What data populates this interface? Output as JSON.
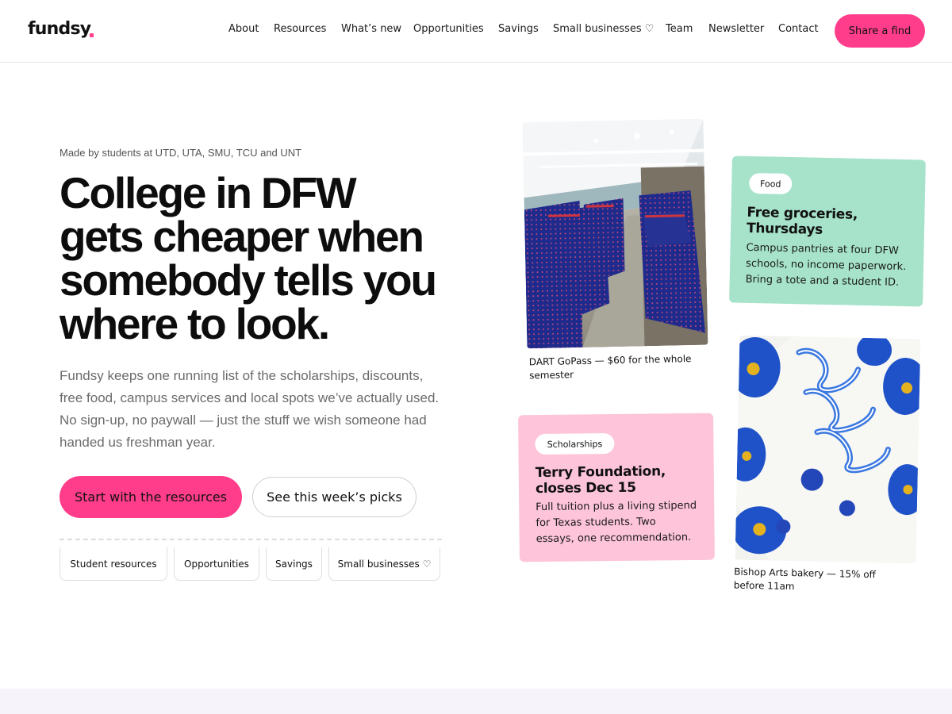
{
  "brand": {
    "name": "fundsy",
    "accent": "#ff3d8b"
  },
  "nav": {
    "items": [
      "About",
      "Resources",
      "What’s new",
      "Opportunities",
      "Savings",
      "Small businesses ♡",
      "Team",
      "Newsletter",
      "Contact"
    ],
    "cta_label": "Share a find"
  },
  "hero": {
    "eyebrow": "Made by students at UTD, UTA, SMU, TCU and UNT",
    "headline_lines": [
      "College in DFW",
      "gets cheaper when",
      "somebody tells you",
      "where to look."
    ],
    "lede": "Fundsy keeps one running list of the scholarships, discounts, free food, campus services and local spots we’ve actually used. No sign-up, no paywall — just the stuff we wish someone had handed us freshman year.",
    "primary_cta": "Start with the resources",
    "secondary_cta": "See this week’s picks",
    "chips": [
      "Student resources",
      "Opportunities",
      "Savings",
      "Small businesses ♡"
    ]
  },
  "cards": {
    "train": {
      "icon": "train-interior-photo",
      "caption_lines": [
        "DART GoPass — $60 for the whole",
        "semester"
      ]
    },
    "food": {
      "tag": "Food",
      "title_lines": [
        "Free groceries,",
        "Thursdays"
      ],
      "body_lines": [
        "Campus pantries at four DFW",
        "schools, no income paperwork.",
        "Bring a tote and a student ID."
      ],
      "color": "#a6e3ca"
    },
    "scholarship": {
      "tag": "Scholarships",
      "title_lines": [
        "Terry Foundation,",
        "closes Dec 15"
      ],
      "body_lines": [
        "Full tuition plus a living stipend",
        "for Texas students. Two",
        "essays, one recommendation."
      ],
      "color": "#fdc4da"
    },
    "cake": {
      "icon": "cake-photo",
      "caption_lines": [
        "Bishop Arts bakery — 15% off",
        "before 11am"
      ]
    }
  }
}
